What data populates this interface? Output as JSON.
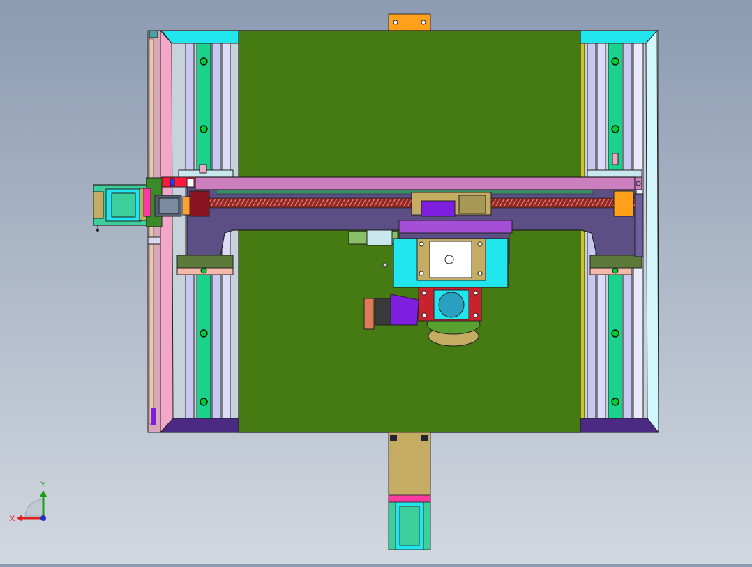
{
  "viewport": {
    "background_top": "#8c9bb2",
    "background_bottom": "#d2d8e0"
  },
  "model": {
    "colors": {
      "green_plate": "#467a12",
      "cyan": "#22e6ee",
      "pink": "#f2a6c8",
      "rail_green": "#1ad28c",
      "purple": "#4b2a84",
      "violet": "#7e1fe0",
      "beam": "#cc7fbe",
      "slate": "#5b4f86",
      "olive": "#5c7a3a",
      "orange": "#ff9f1a",
      "tan": "#c4ad63",
      "motor_teal": "#3ccf9c",
      "red": "#c8222e"
    }
  },
  "triad": {
    "x_label": "X",
    "y_label": "Y",
    "x_color": "#e02020",
    "y_color": "#1aa01a",
    "z_color": "#2030c0"
  }
}
